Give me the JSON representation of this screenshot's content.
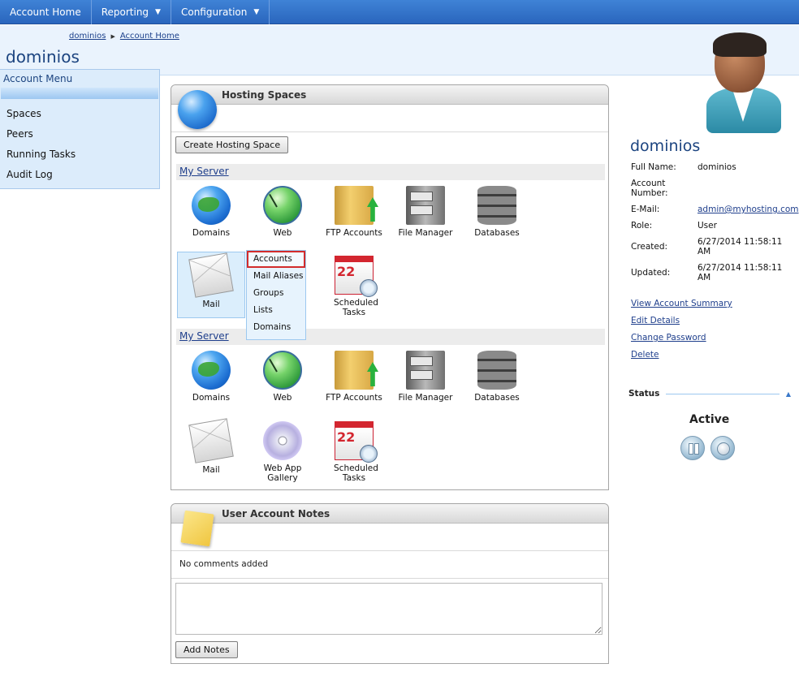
{
  "nav": {
    "items": [
      {
        "label": "Account Home",
        "has_caret": false
      },
      {
        "label": "Reporting",
        "has_caret": true
      },
      {
        "label": "Configuration",
        "has_caret": true
      }
    ]
  },
  "breadcrumb": {
    "items": [
      "dominios",
      "Account Home"
    ]
  },
  "page_title": "dominios",
  "account_menu": {
    "title": "Account Menu",
    "items": [
      "Spaces",
      "Peers",
      "Running Tasks",
      "Audit Log"
    ]
  },
  "hosting_spaces": {
    "title": "Hosting Spaces",
    "create_button": "Create Hosting Space",
    "servers": [
      {
        "name": "My Server",
        "tiles": [
          {
            "label": "Domains",
            "icon": "globe-icon"
          },
          {
            "label": "Web",
            "icon": "web-icon"
          },
          {
            "label": "FTP Accounts",
            "icon": "ftp-folder-icon"
          },
          {
            "label": "File Manager",
            "icon": "file-cabinet-icon"
          },
          {
            "label": "Databases",
            "icon": "database-icon"
          },
          {
            "label": "Mail",
            "icon": "mail-envelope-icon"
          },
          {
            "label": "Scheduled Tasks",
            "icon": "calendar-clock-icon"
          }
        ]
      },
      {
        "name": "My Server",
        "tiles": [
          {
            "label": "Domains",
            "icon": "globe-icon"
          },
          {
            "label": "Web",
            "icon": "web-icon"
          },
          {
            "label": "FTP Accounts",
            "icon": "ftp-folder-icon"
          },
          {
            "label": "File Manager",
            "icon": "file-cabinet-icon"
          },
          {
            "label": "Databases",
            "icon": "database-icon"
          },
          {
            "label": "Mail",
            "icon": "mail-envelope-icon"
          },
          {
            "label": "Web App Gallery",
            "icon": "cd-disc-icon"
          },
          {
            "label": "Scheduled Tasks",
            "icon": "calendar-clock-icon"
          }
        ]
      }
    ],
    "mail_menu": {
      "items": [
        "Accounts",
        "Mail Aliases",
        "Groups",
        "Lists",
        "Domains"
      ],
      "selected": "Accounts"
    }
  },
  "notes": {
    "title": "User Account Notes",
    "empty_text": "No comments added",
    "textarea_value": "",
    "add_button": "Add Notes"
  },
  "account": {
    "name": "dominios",
    "details": [
      {
        "key": "Full Name:",
        "value": "dominios"
      },
      {
        "key": "Account Number:",
        "value": ""
      },
      {
        "key": "E-Mail:",
        "value": "admin@myhosting.com"
      },
      {
        "key": "Role:",
        "value": "User"
      },
      {
        "key": "Created:",
        "value": "6/27/2014 11:58:11 AM"
      },
      {
        "key": "Updated:",
        "value": "6/27/2014 11:58:11 AM"
      }
    ],
    "links": [
      "View Account Summary",
      "Edit Details",
      "Change Password",
      "Delete"
    ]
  },
  "status": {
    "title": "Status",
    "value": "Active"
  },
  "colors": {
    "nav_blue": "#2a66bd",
    "title_blue": "#1c4480",
    "link_blue": "#1f3f8c",
    "highlight_red": "#d22c2c"
  }
}
